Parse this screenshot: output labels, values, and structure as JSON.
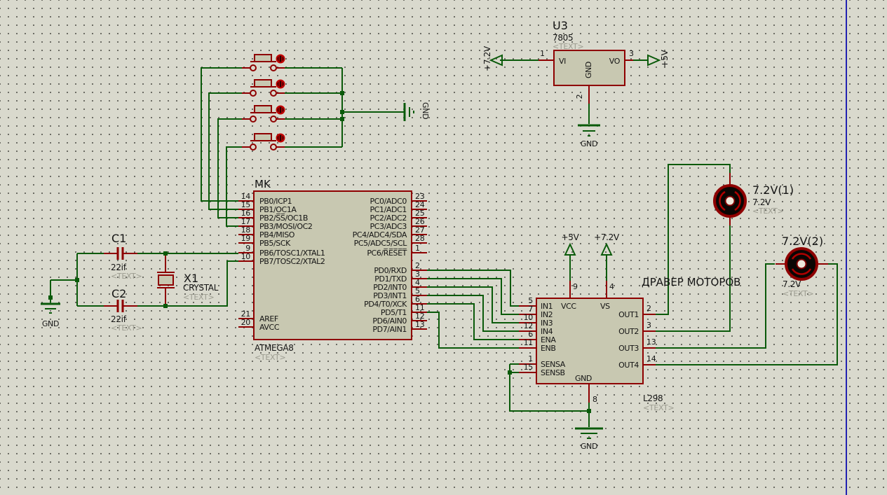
{
  "app": {
    "background": "#d9d9cd",
    "grid_dot_color": "#50504a",
    "sheet_border_color": "#2222b2"
  },
  "colors": {
    "wire_green": "#0a5a0a",
    "component_red": "#8e0000",
    "chip_fill": "#c8c8b1",
    "bright_red": "#c40000",
    "text_black": "#141414",
    "placeholder_gray": "#9c9c90"
  },
  "annotation": {
    "motor_driver_caption": "ДРАВЕР МОТОРОВ"
  },
  "u3": {
    "ref": "U3",
    "value": "7805",
    "placeholder": "<TEXT>",
    "pin_vi": "VI",
    "pin_vo": "VO",
    "pin_gnd": "GND",
    "num_vi": "1",
    "num_vo": "3",
    "num_gnd": "2",
    "net_in": "+7.2V",
    "net_out": "+5V",
    "gnd_label": "GND"
  },
  "mk": {
    "ref": "MK",
    "value": "ATMEGA8",
    "placeholder": "<TEXT>",
    "left_pins": [
      {
        "num": "14",
        "name": "PB0/ICP1"
      },
      {
        "num": "15",
        "name": "PB1/OC1A"
      },
      {
        "num": "16",
        "name": "PB2/S̅S̅/OC1B"
      },
      {
        "num": "17",
        "name": "PB3/MOSI/OC2"
      },
      {
        "num": "18",
        "name": "PB4/MISO"
      },
      {
        "num": "19",
        "name": "PB5/SCK"
      },
      {
        "num": "9",
        "name": "PB6/TOSC1/XTAL1"
      },
      {
        "num": "10",
        "name": "PB7/TOSC2/XTAL2"
      },
      {
        "num": "21",
        "name": "AREF"
      },
      {
        "num": "20",
        "name": "AVCC"
      }
    ],
    "right_pins": [
      {
        "num": "23",
        "name": "PC0/ADC0"
      },
      {
        "num": "24",
        "name": "PC1/ADC1"
      },
      {
        "num": "25",
        "name": "PC2/ADC2"
      },
      {
        "num": "26",
        "name": "PC3/ADC3"
      },
      {
        "num": "27",
        "name": "PC4/ADC4/SDA"
      },
      {
        "num": "28",
        "name": "PC5/ADC5/SCL"
      },
      {
        "num": "1",
        "name": "PC6/R̅E̅S̅E̅T̅"
      },
      {
        "num": "2",
        "name": "PD0/RXD"
      },
      {
        "num": "3",
        "name": "PD1/TXD"
      },
      {
        "num": "4",
        "name": "PD2/INT0"
      },
      {
        "num": "5",
        "name": "PD3/INT1"
      },
      {
        "num": "6",
        "name": "PD4/T0/XCK"
      },
      {
        "num": "11",
        "name": "PD5/T1"
      },
      {
        "num": "12",
        "name": "PD6/AIN0"
      },
      {
        "num": "13",
        "name": "PD7/AIN1"
      }
    ]
  },
  "l298": {
    "ref": "L298",
    "placeholder": "<TEXT>",
    "left_pins": [
      {
        "num": "5",
        "name": "IN1"
      },
      {
        "num": "7",
        "name": "IN2"
      },
      {
        "num": "10",
        "name": "IN3"
      },
      {
        "num": "12",
        "name": "IN4"
      },
      {
        "num": "6",
        "name": "ENA"
      },
      {
        "num": "11",
        "name": "ENB"
      },
      {
        "num": "1",
        "name": "SENSA"
      },
      {
        "num": "15",
        "name": "SENSB"
      }
    ],
    "right_pins": [
      {
        "num": "2",
        "name": "OUT1"
      },
      {
        "num": "3",
        "name": "OUT2"
      },
      {
        "num": "13",
        "name": "OUT3"
      },
      {
        "num": "14",
        "name": "OUT4"
      }
    ],
    "pin_vcc": "VCC",
    "num_vcc": "9",
    "net_vcc": "+5V",
    "pin_vs": "VS",
    "num_vs": "4",
    "net_vs": "+7.2V",
    "pin_gnd": "GND",
    "num_gnd": "8",
    "gnd_label": "GND"
  },
  "capacitors": [
    {
      "ref": "C1",
      "value": "22if",
      "placeholder": "<TEXT>"
    },
    {
      "ref": "C2",
      "value": "22if",
      "placeholder": "<TEXT>"
    }
  ],
  "crystal": {
    "ref": "X1",
    "value": "CRYSTAL",
    "placeholder": "<TEXT>"
  },
  "motors": [
    {
      "ref": "7.2V(1)",
      "value": "7.2V",
      "placeholder": "<TEXT>"
    },
    {
      "ref": "7.2V(2)",
      "value": "7.2V",
      "placeholder": "<TEXT>"
    }
  ],
  "grounds": {
    "buttons_gnd": "GND",
    "crystal_gnd": "GND"
  }
}
